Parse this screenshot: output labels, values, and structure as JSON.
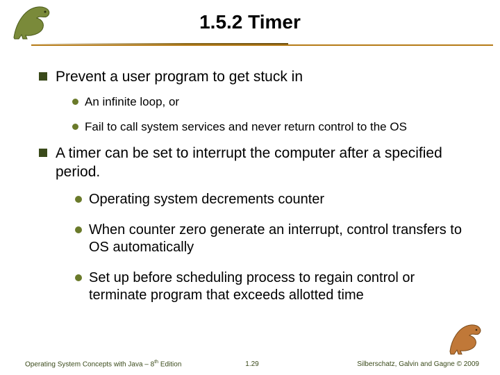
{
  "title": "1.5.2 Timer",
  "bullets": {
    "b1": "Prevent a user program to get stuck in",
    "b1_subs": {
      "s1": "An infinite loop, or",
      "s2": "Fail to call system services and never return control to the OS"
    },
    "b2": "A timer can be set to interrupt the computer after a specified period.",
    "b2_subs": {
      "s1": "Operating system decrements counter",
      "s2": "When counter zero generate an interrupt, control transfers to OS automatically",
      "s3": "Set up before scheduling process to regain control or terminate program that exceeds allotted time"
    }
  },
  "footer": {
    "left_a": "Operating System Concepts with Java – 8",
    "left_sup": "th",
    "left_b": " Edition",
    "center": "1.29",
    "right": "Silberschatz, Galvin and Gagne © 2009"
  }
}
